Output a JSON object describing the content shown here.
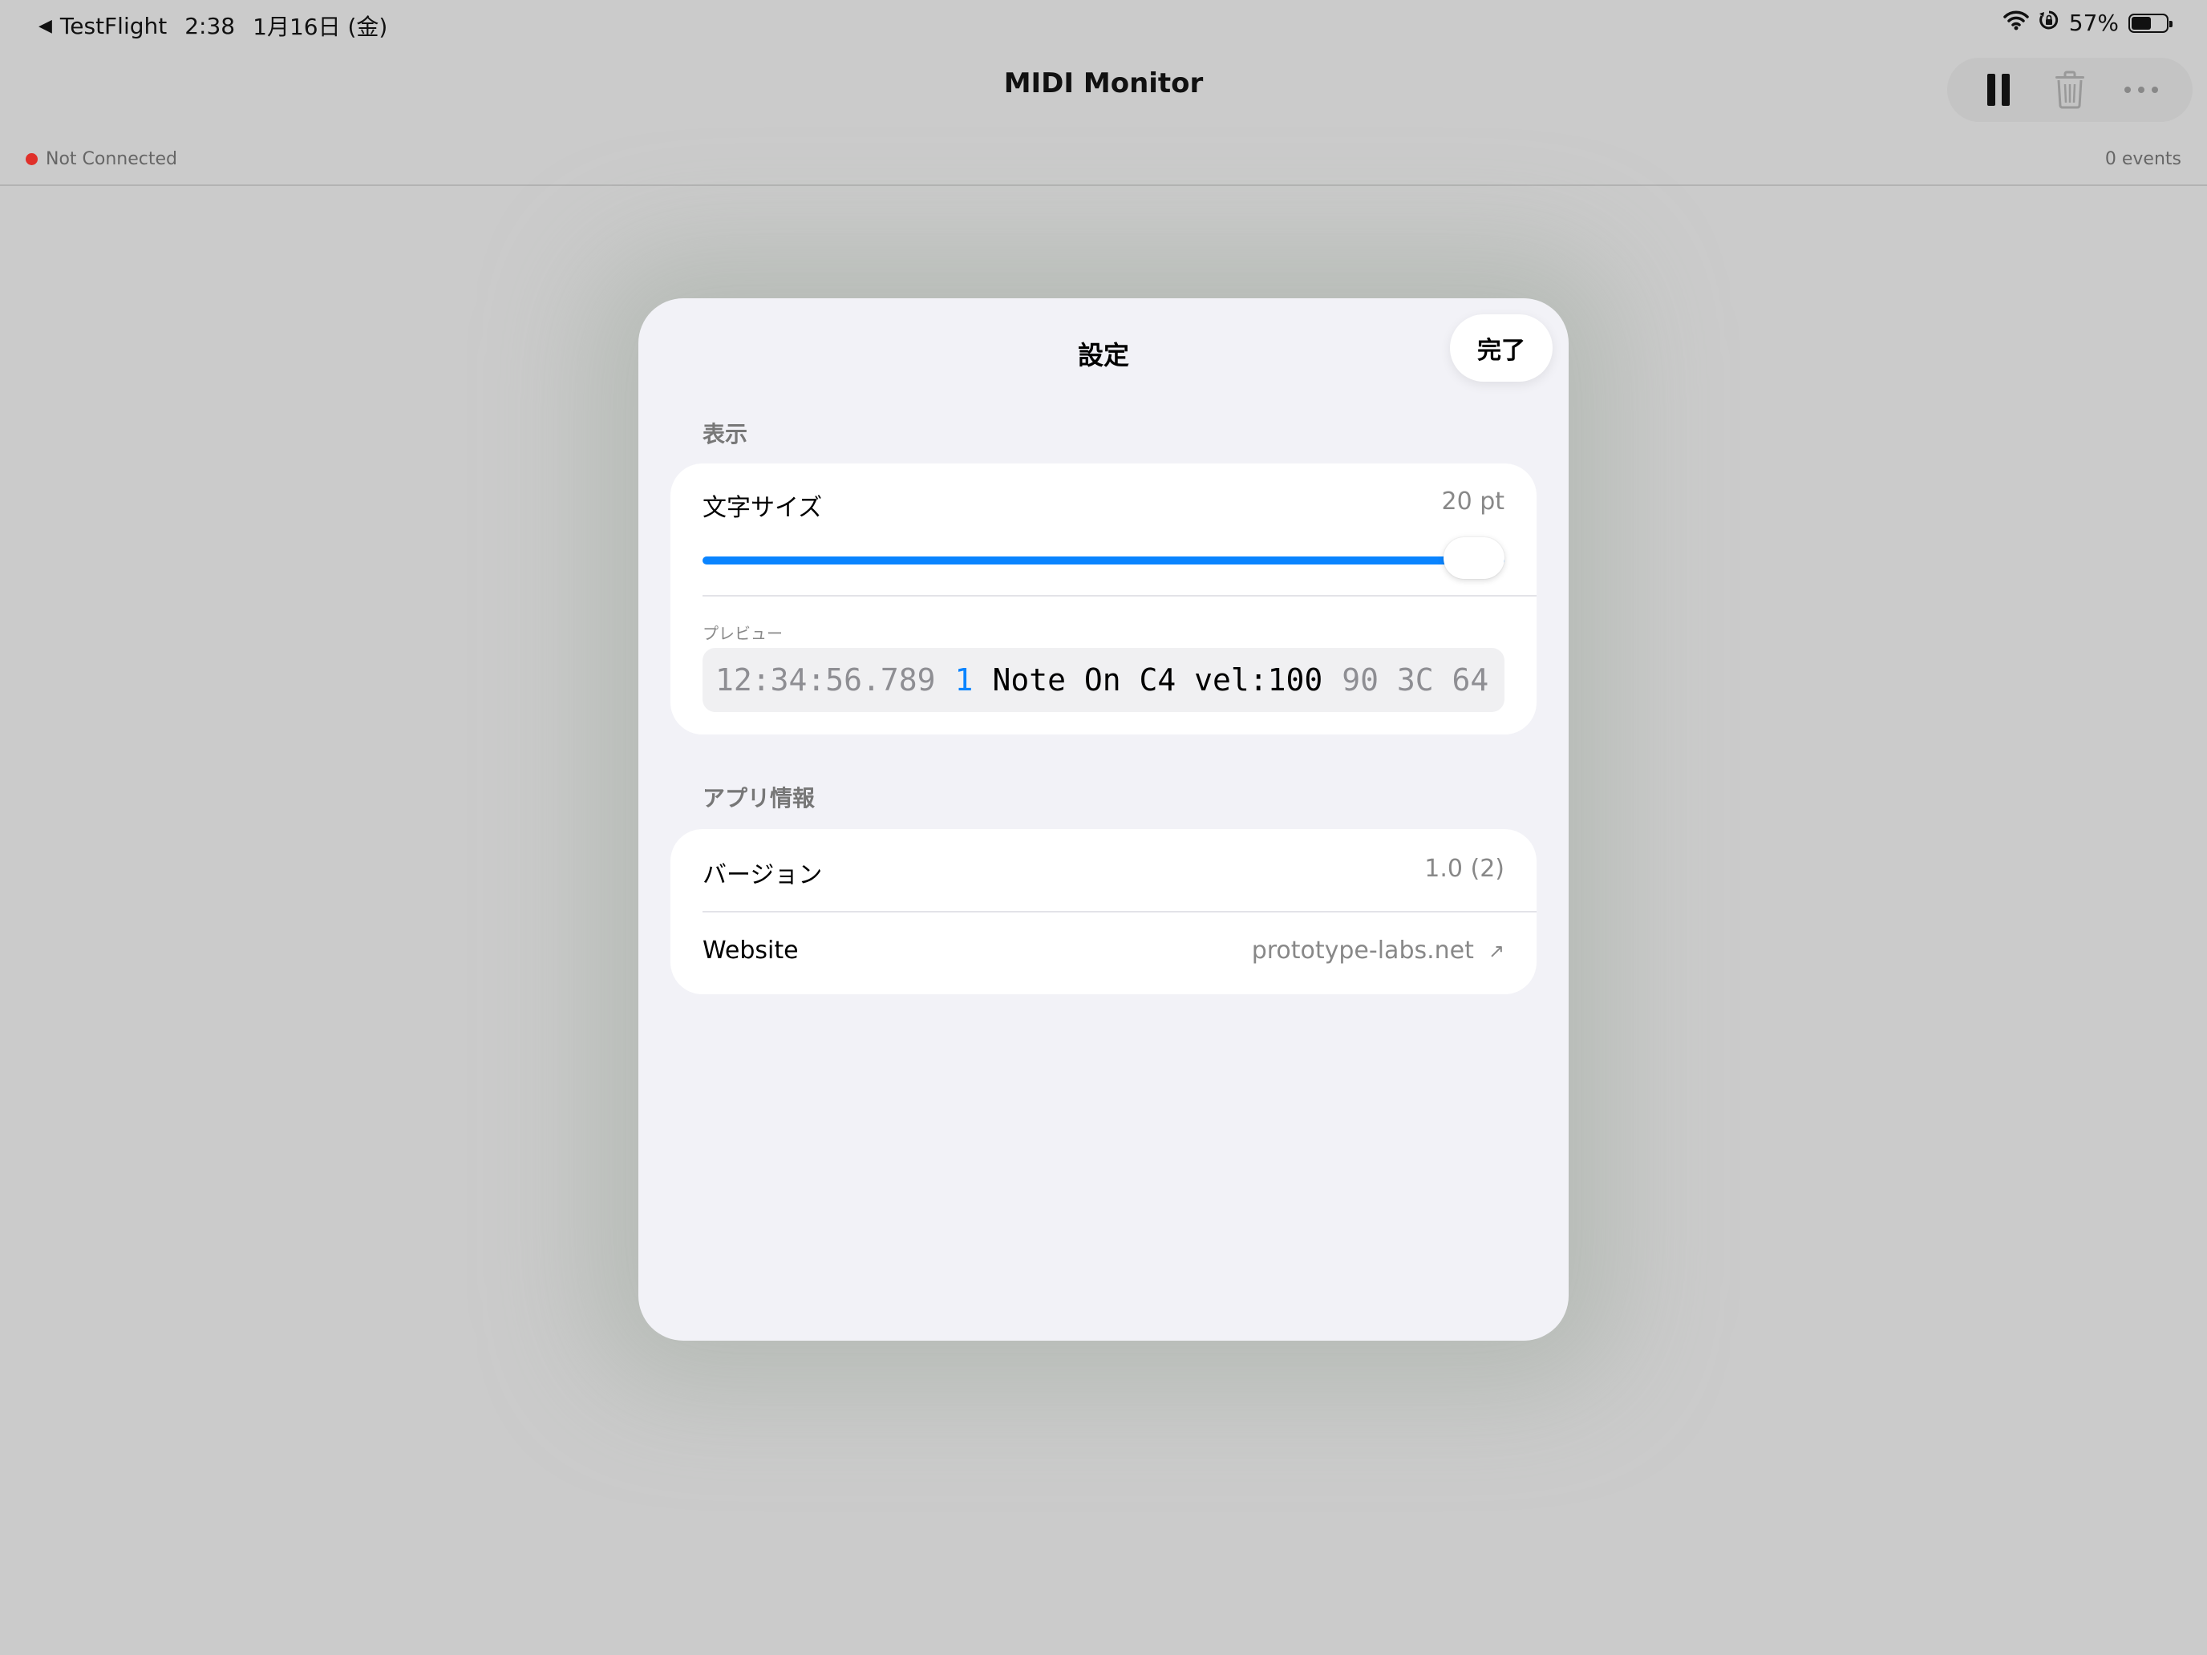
{
  "status_bar": {
    "back_app": "TestFlight",
    "time": "2:38",
    "date": "1月16日 (金)",
    "battery": "57%",
    "battery_level": 0.57,
    "icons": [
      "wifi-icon",
      "orientation-lock-icon",
      "battery-icon"
    ]
  },
  "nav": {
    "title": "MIDI Monitor",
    "actions": [
      "pause-icon",
      "trash-icon",
      "more-icon"
    ]
  },
  "info_bar": {
    "connection": "Not Connected",
    "events": "0 events",
    "status_color": "#e0302a"
  },
  "settings": {
    "title": "設定",
    "done": "完了",
    "display": {
      "header": "表示",
      "font_size_label": "文字サイズ",
      "font_size_value": "20 pt",
      "slider_fraction": 1.0,
      "preview_label": "プレビュー",
      "preview": {
        "time": "12:34:56.789",
        "channel": "1",
        "message": "Note On C4 vel:100",
        "hex": "90 3C 64"
      }
    },
    "app_info": {
      "header": "アプリ情報",
      "version_label": "バージョン",
      "version_value": "1.0 (2)",
      "website_label": "Website",
      "website_value": "prototype-labs.net"
    }
  },
  "colors": {
    "accent": "#0a84ff",
    "background": "#cbcbcb",
    "sheet": "#f2f2f7"
  }
}
